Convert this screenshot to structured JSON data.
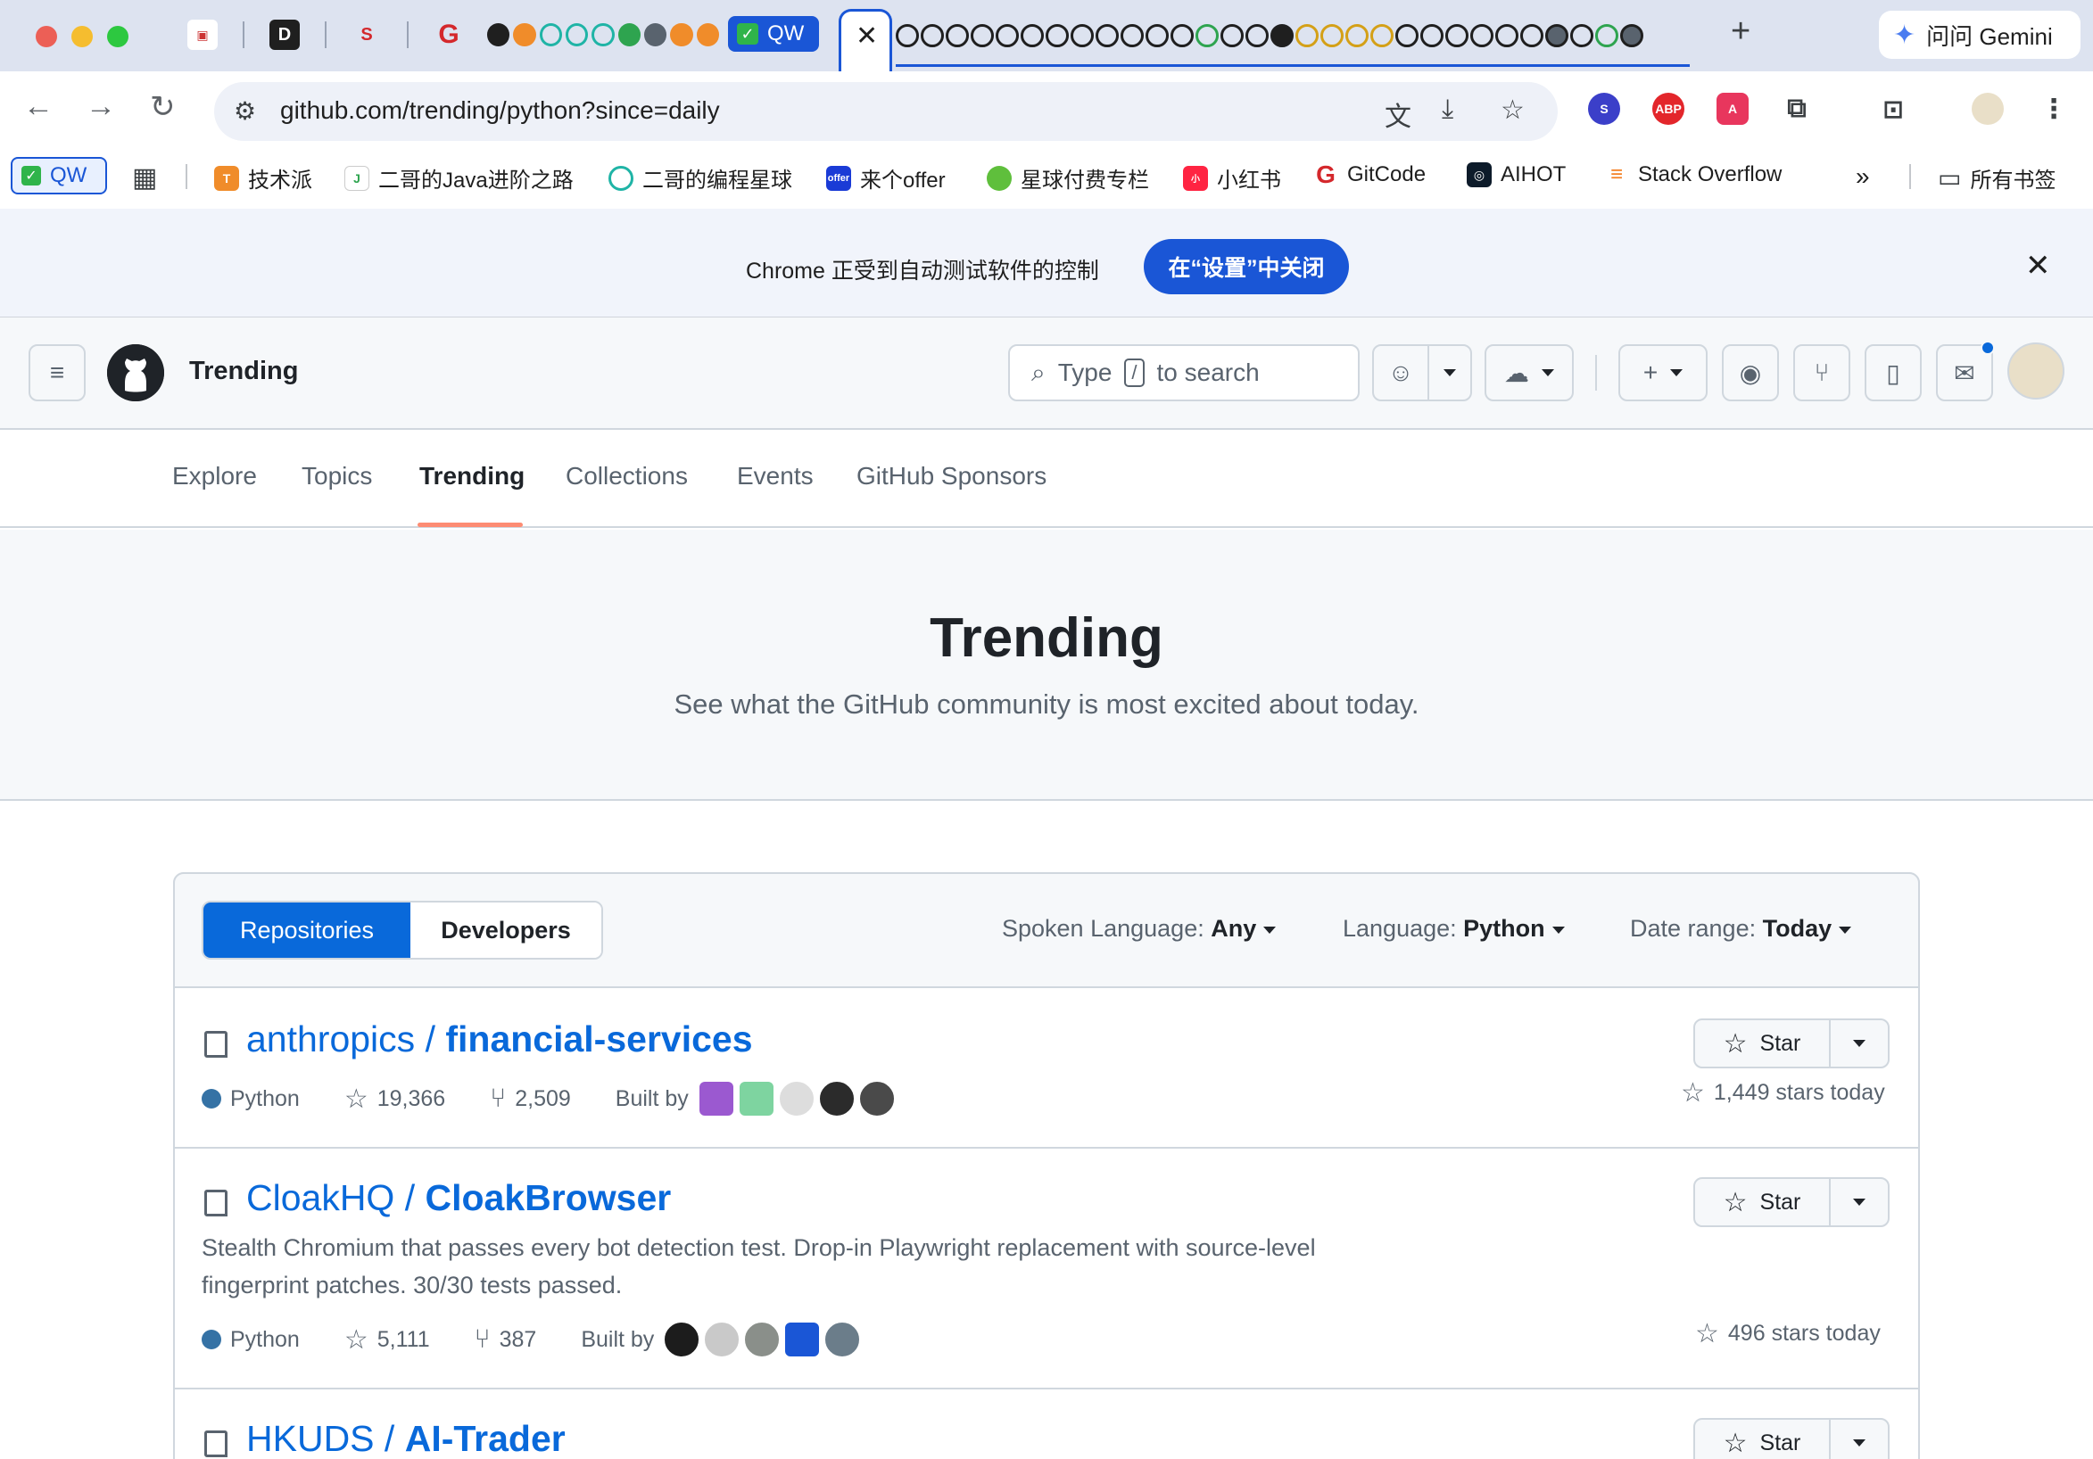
{
  "browser": {
    "tab_qw_label": "QW",
    "active_tab_close": "✕",
    "new_tab": "+",
    "gemini_label": "问问 Gemini",
    "url": "github.com/trending/python?since=daily"
  },
  "bookmarks": {
    "qw": "QW",
    "items": [
      "技术派",
      "二哥的Java进阶之路",
      "二哥的编程星球",
      "来个offer",
      "星球付费专栏",
      "小红书",
      "GitCode",
      "AIHOT",
      "Stack Overflow"
    ],
    "more": "»",
    "all": "所有书签"
  },
  "automation_bar": {
    "message": "Chrome 正受到自动测试软件的控制",
    "button": "在“设置”中关闭",
    "close": "✕"
  },
  "header": {
    "title": "Trending",
    "search_prefix": "Type",
    "search_key": "/",
    "search_suffix": "to search"
  },
  "subnav": {
    "items": [
      "Explore",
      "Topics",
      "Trending",
      "Collections",
      "Events",
      "GitHub Sponsors"
    ],
    "active": "Trending"
  },
  "hero": {
    "title": "Trending",
    "subtitle": "See what the GitHub community is most excited about today."
  },
  "filters": {
    "tab_repositories": "Repositories",
    "tab_developers": "Developers",
    "spoken_label": "Spoken Language:",
    "spoken_value": "Any",
    "language_label": "Language:",
    "language_value": "Python",
    "date_label": "Date range:",
    "date_value": "Today"
  },
  "repos": [
    {
      "owner": "anthropics",
      "name": "financial-services",
      "description": "",
      "language": "Python",
      "stars": "19,366",
      "forks": "2,509",
      "built_by": "Built by",
      "stars_today": "1,449 stars today",
      "star_label": "Star"
    },
    {
      "owner": "CloakHQ",
      "name": "CloakBrowser",
      "description_line1": "Stealth Chromium that passes every bot detection test. Drop-in Playwright replacement with source-level",
      "description_line2": "fingerprint patches. 30/30 tests passed.",
      "language": "Python",
      "stars": "5,111",
      "forks": "387",
      "built_by": "Built by",
      "stars_today": "496 stars today",
      "star_label": "Star"
    },
    {
      "owner": "HKUDS",
      "name": "AI-Trader",
      "star_label": "Star"
    }
  ],
  "colors": {
    "accent": "#0969da",
    "python": "#3572A5",
    "chrome_blue": "#1a56d6"
  }
}
